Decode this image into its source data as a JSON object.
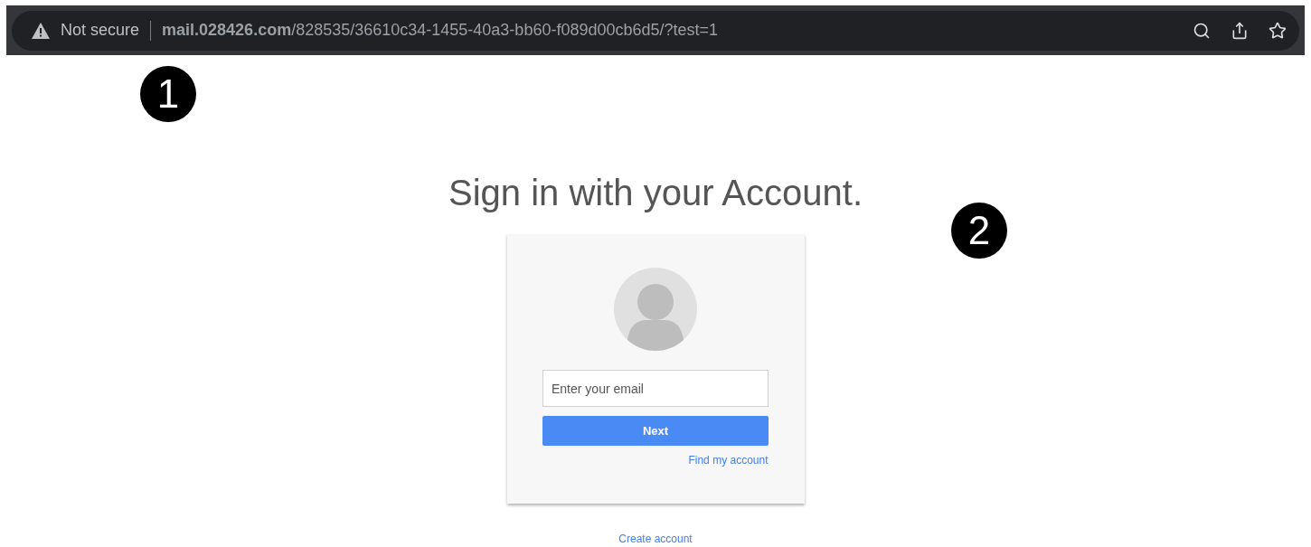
{
  "address_bar": {
    "security": "Not secure",
    "url": "**mail.028426.com**/828535/36610c34-1455-40a3-bb60-f089d00cb6d5/?test=1"
  },
  "page": {
    "heading": "Sign in with your Account.",
    "email": {
      "placeholder": "Enter your email"
    },
    "next_button": "Next",
    "find_account_link": "Find my account",
    "create_account_link": "Create account"
  },
  "callouts": [
    {
      "number": "1"
    },
    {
      "number": "2"
    }
  ]
}
